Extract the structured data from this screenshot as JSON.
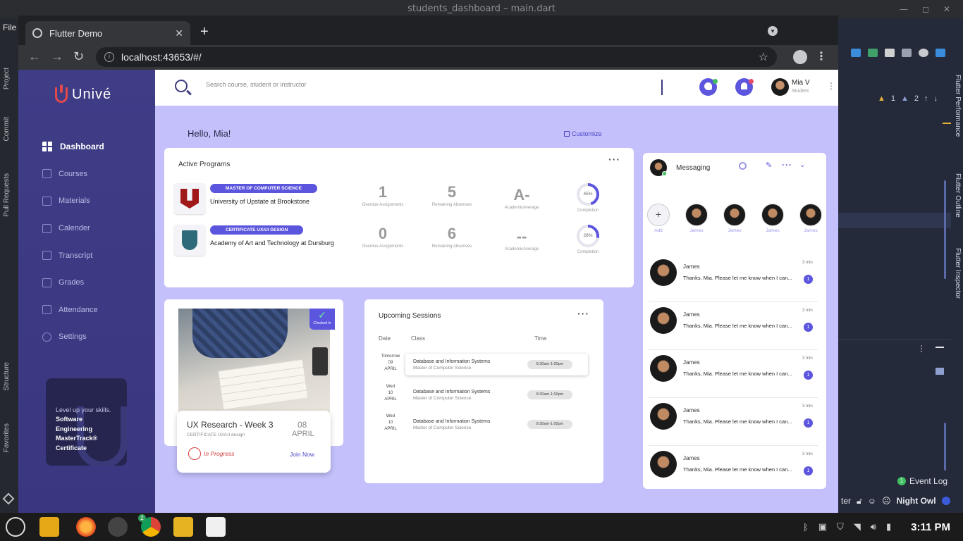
{
  "ide": {
    "window_title": "students_dashboard – main.dart",
    "file_menu": "File",
    "left_tabs": [
      "Project",
      "Commit",
      "Pull Requests",
      "Structure",
      "Favorites"
    ],
    "right_tabs": [
      "Flutter Performance",
      "Flutter Outline",
      "Flutter Inspector"
    ],
    "warnings": "1",
    "weak_warnings": "2",
    "event_log": "Event Log",
    "event_log_count": "1",
    "status_fragment": "ter",
    "theme": "Night Owl"
  },
  "browser": {
    "tab_title": "Flutter Demo",
    "url": "localhost:43653/#/"
  },
  "app": {
    "brand": "Univé",
    "search_placeholder": "Search course, student or instructor",
    "user": {
      "name": "Mia V",
      "role": "Student"
    },
    "greeting": "Hello, Mia!",
    "customize": "Customize",
    "nav": [
      {
        "label": "Dashboard",
        "icon": "grid-icon",
        "active": true
      },
      {
        "label": "Courses",
        "icon": "book-icon",
        "active": false
      },
      {
        "label": "Materials",
        "icon": "document-icon",
        "active": false
      },
      {
        "label": "Calender",
        "icon": "calendar-icon",
        "active": false
      },
      {
        "label": "Transcript",
        "icon": "transcript-icon",
        "active": false
      },
      {
        "label": "Grades",
        "icon": "star-icon",
        "active": false
      },
      {
        "label": "Attendance",
        "icon": "person-check-icon",
        "active": false
      },
      {
        "label": "Settings",
        "icon": "gear-icon",
        "active": false
      }
    ],
    "promo": {
      "lead": "Level up your skills.",
      "lines": [
        "Software",
        "Engineering",
        "MasterTrack®",
        "Certificate"
      ]
    },
    "active_programs": {
      "title": "Active Programs",
      "programs": [
        {
          "badge": "MASTER OF COMPUTER SCIENCE",
          "school": "University of Upstate at Brookstone",
          "overdue": "1",
          "overdue_label": "Overdue Assignments",
          "absences": "5",
          "absences_label": "Remaining Absenses",
          "average": "A-",
          "average_label": "AcademicAverage",
          "completion": 45,
          "completion_text": "45%",
          "completion_label": "Completion"
        },
        {
          "badge": "CERTIFICATE UX/UI DESIGN",
          "school": "Academy of Art and Technology at Dursburg",
          "overdue": "0",
          "overdue_label": "Overdue Assignments",
          "absences": "6",
          "absences_label": "Remaining Absenses",
          "average": "--",
          "average_label": "AcademicAverage",
          "completion": 28,
          "completion_text": "28%",
          "completion_label": "Completion"
        }
      ]
    },
    "lesson": {
      "checkin": "Checked In",
      "title": "UX Research - Week 3",
      "subtitle": "CERTIFICATE UX/UI design",
      "day": "08",
      "month": "APRIL",
      "status": "In Progress",
      "action": "Join Now"
    },
    "sessions": {
      "title": "Upcoming Sessions",
      "headers": {
        "date": "Date",
        "class": "Class",
        "time": "Time"
      },
      "rows": [
        {
          "date_top": "Tomorrow",
          "date_day": "09",
          "date_month": "APRIL",
          "class": "Database and Information Systems",
          "program": "Master of Computer Science",
          "time": "8:30am-1:00pm",
          "highlighted": true
        },
        {
          "date_top": "Wed",
          "date_day": "10",
          "date_month": "APRIL",
          "class": "Database and Information Systems",
          "program": "Master of Computer Science",
          "time": "8:30am-1:00pm",
          "highlighted": false
        },
        {
          "date_top": "Wed",
          "date_day": "10",
          "date_month": "APRIL",
          "class": "Database and Information Systems",
          "program": "Master of Computer Science",
          "time": "8:30am-1:00pm",
          "highlighted": false
        }
      ]
    },
    "messaging": {
      "title": "Messaging",
      "add_label": "Add",
      "contacts": [
        "James",
        "James",
        "James",
        "James"
      ],
      "messages": [
        {
          "name": "James",
          "text": "Thanks, Mia. Please let me know when I can...",
          "time": "3 min",
          "count": "1"
        },
        {
          "name": "James",
          "text": "Thanks, Mia. Please let me know when I can...",
          "time": "3 min",
          "count": "1"
        },
        {
          "name": "James",
          "text": "Thanks, Mia. Please let me know when I can...",
          "time": "3 min",
          "count": "1"
        },
        {
          "name": "James",
          "text": "Thanks, Mia. Please let me know when I can...",
          "time": "3 min",
          "count": "1"
        },
        {
          "name": "James",
          "text": "Thanks, Mia. Please let me know when I can...",
          "time": "3 min",
          "count": "1"
        }
      ]
    }
  },
  "taskbar": {
    "chrome_badge": "2",
    "clock": "3:11 PM"
  },
  "colors": {
    "accent": "#5c55de",
    "sidebar": "#3f3d86",
    "page_bg": "#c3c0fb",
    "danger": "#d43a3a"
  }
}
